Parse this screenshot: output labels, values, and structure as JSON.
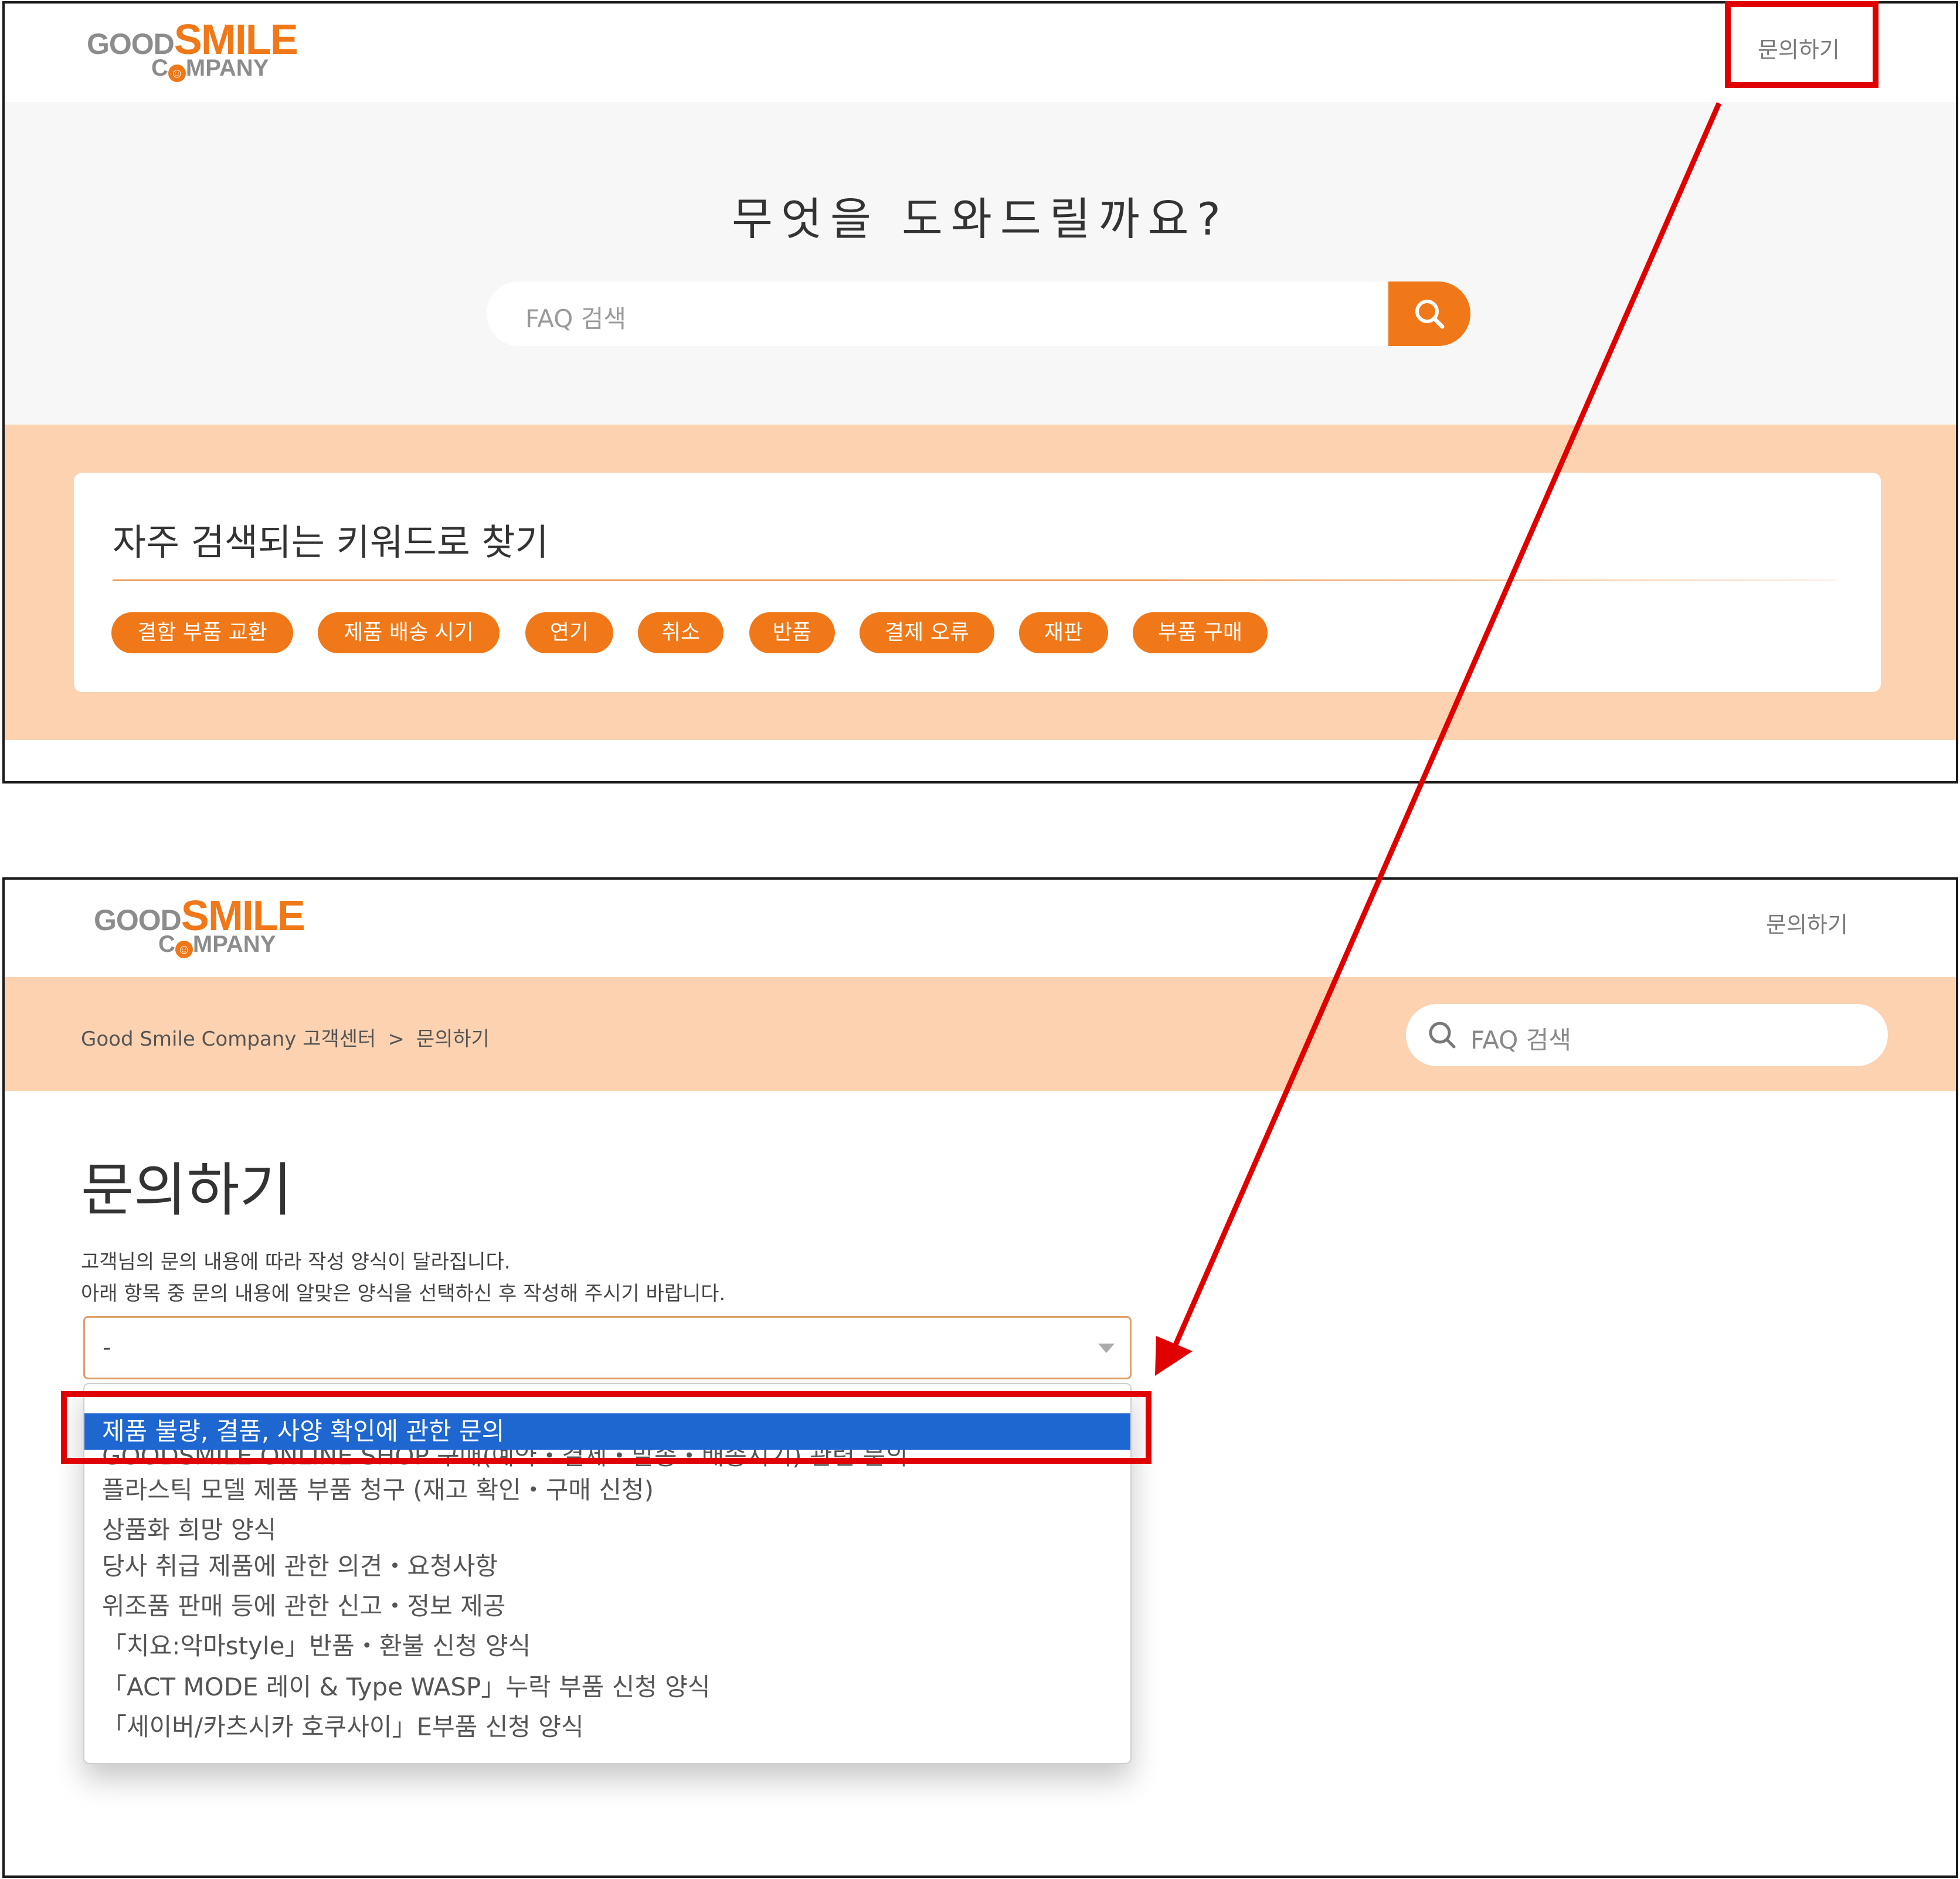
{
  "brand": {
    "good": "GOOD",
    "smile": "SMILE",
    "company_pre": "C",
    "company_smiley": "☺",
    "company_post": "MPANY"
  },
  "colors": {
    "accent": "#f07818",
    "peach": "#fdd2b0",
    "annotation_red": "#e00000",
    "selected_blue": "#1e66d0"
  },
  "header": {
    "contact_label": "문의하기"
  },
  "faq_home": {
    "hero_title": "무엇을 도와드릴까요?",
    "search": {
      "placeholder": "FAQ 검색",
      "button_icon": "search-icon"
    },
    "keywords": {
      "title": "자주 검색되는 키워드로 찾기",
      "chips": [
        "결함 부품 교환",
        "제품 배송 시기",
        "연기",
        "취소",
        "반품",
        "결제 오류",
        "재판",
        "부품 구매"
      ]
    }
  },
  "inquiry_page": {
    "breadcrumb": [
      "Good Smile Company 고객센터",
      ">",
      "문의하기"
    ],
    "search": {
      "placeholder": "FAQ 검색"
    },
    "title": "문의하기",
    "desc": [
      "고객님의 문의 내용에 따라 작성 양식이 달라집니다.",
      "아래 항목 중 문의 내용에 알맞은 양식을 선택하신 후 작성해 주시기 바랍니다."
    ],
    "select": {
      "value": "-",
      "options": [
        "제품 불량, 결품, 사양 확인에 관한 문의",
        "GOODSMILE ONLINE SHOP 구매(예약・결제・발송・배송시기) 관련 문의",
        "플라스틱 모델 제품 부품 청구 (재고 확인・구매 신청)",
        "상품화 희망 양식",
        "당사 취급 제품에 관한 의견・요청사항",
        "위조품 판매 등에 관한 신고・정보 제공",
        "「치요:악마style」반품・환불 신청 양식",
        "「ACT MODE 레이 & Type WASP」누락 부품 신청 양식",
        "「세이버/카츠시카 호쿠사이」E부품 신청 양식"
      ],
      "selected_index": 0
    }
  }
}
